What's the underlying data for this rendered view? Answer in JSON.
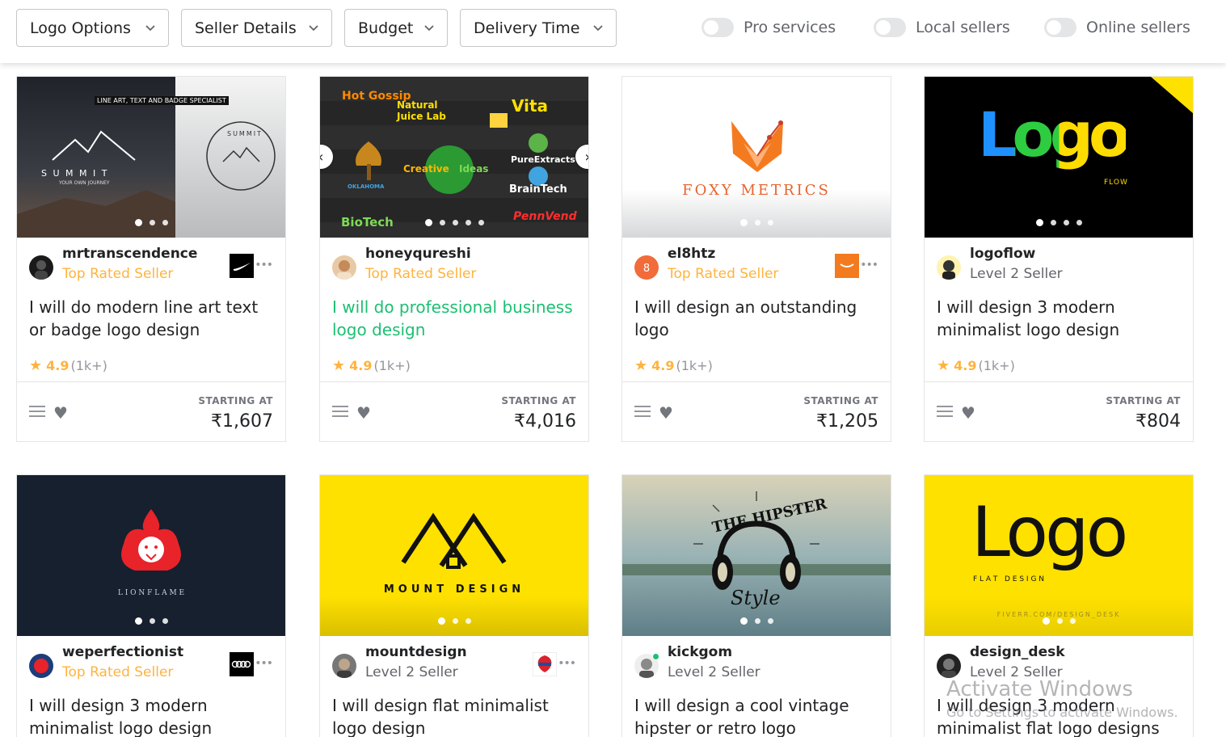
{
  "filters": {
    "logo_options": "Logo Options",
    "seller_details": "Seller Details",
    "budget": "Budget",
    "delivery_time": "Delivery Time",
    "pro_services": "Pro services",
    "local_sellers": "Local sellers",
    "online_sellers": "Online sellers"
  },
  "labels": {
    "starting_at": "STARTING AT"
  },
  "gigs": [
    {
      "seller": "mrtranscendence",
      "level": "Top Rated Seller",
      "title": "I will do modern line art text or badge logo design",
      "score": "4.9",
      "count": "(1k+)",
      "price": "₹1,607",
      "thumb": {
        "tagline": "LINE ART, TEXT AND BADGE SPECIALIST",
        "brand": "S U M M I T",
        "sub": "YOUR OWN JOURNEY",
        "badge_text": "SUMMIT"
      }
    },
    {
      "seller": "honeyqureshi",
      "level": "Top Rated Seller",
      "title": "I will do professional business logo design",
      "score": "4.9",
      "count": "(1k+)",
      "price": "₹4,016",
      "thumb": {
        "w1": "Hot Gossip",
        "w2": "Natural Juice Lab",
        "w3": "Vita",
        "w4": "Creative",
        "w5": "Ideas",
        "w6": "PureExtracts",
        "w7": "BrainTech",
        "w8": "BioTech",
        "w9": "PennVend",
        "w10": "OKLAHOMA"
      }
    },
    {
      "seller": "el8htz",
      "level": "Top Rated Seller",
      "title": "I will design an outstanding logo",
      "score": "4.9",
      "count": "(1k+)",
      "price": "₹1,205",
      "thumb": {
        "brand": "FOXY METRICS"
      }
    },
    {
      "seller": "logoflow",
      "level": "Level 2 Seller",
      "title": "I will design 3 modern minimalist logo design",
      "score": "4.9",
      "count": "(1k+)",
      "price": "₹804",
      "thumb": {
        "brand": "Logo",
        "sub": "FLOW"
      }
    },
    {
      "seller": "weperfectionist",
      "level": "Top Rated Seller",
      "title": "I will design 3 modern minimalist logo design",
      "thumb": {
        "brand": "L I O N F L A M E"
      }
    },
    {
      "seller": "mountdesign",
      "level": "Level 2 Seller",
      "title": "I will design flat minimalist logo design",
      "thumb": {
        "brand": "MOUNT DESIGN"
      }
    },
    {
      "seller": "kickgom",
      "level": "Level 2 Seller",
      "title": "I will design a cool vintage hipster or retro logo",
      "thumb": {
        "top": "THE HIPSTER",
        "script": "Style"
      }
    },
    {
      "seller": "design_desk",
      "level": "Level 2 Seller",
      "title": "I will design 3 modern minimalist flat logo designs",
      "thumb": {
        "brand": "Logo",
        "sub": "F L A T   D E S I G N",
        "foot": "FIVERR.COM/DESIGN_DESK"
      }
    }
  ],
  "watermark": {
    "title": "Activate Windows",
    "sub": "Go to Settings to activate Windows."
  }
}
